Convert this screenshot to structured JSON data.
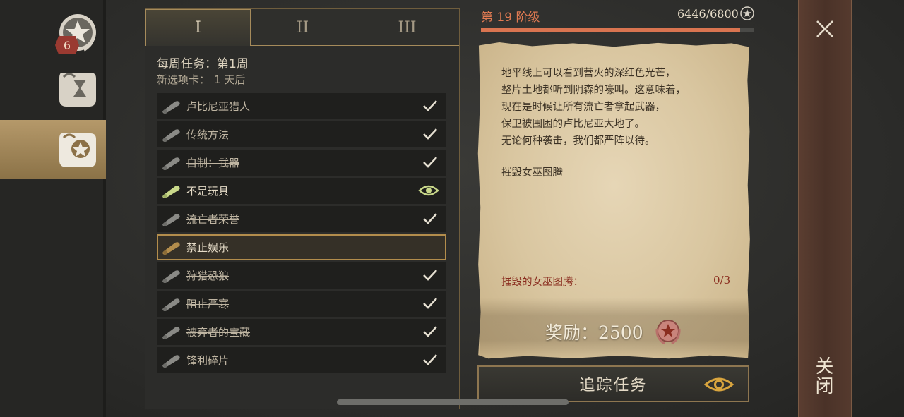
{
  "side_nav": {
    "badge_count": "6",
    "items": [
      {
        "icon": "laurel-star-icon"
      },
      {
        "icon": "scroll-hourglass-icon"
      },
      {
        "icon": "scroll-star-icon",
        "active": true
      }
    ]
  },
  "tabs": [
    "I",
    "II",
    "III"
  ],
  "active_tab": 0,
  "week": {
    "title": "每周任务：第1周",
    "next_card_label": "新选项卡：",
    "next_card_value": "1 天后"
  },
  "quests": [
    {
      "label": "卢比尼亚猎人",
      "state": "done"
    },
    {
      "label": "传统方法",
      "state": "done"
    },
    {
      "label": "自制：武器",
      "state": "done"
    },
    {
      "label": "不是玩具",
      "state": "tracked"
    },
    {
      "label": "流亡者荣誉",
      "state": "done"
    },
    {
      "label": "禁止娱乐",
      "state": "selected"
    },
    {
      "label": "狩猎恐狼",
      "state": "done"
    },
    {
      "label": "阻止严寒",
      "state": "done"
    },
    {
      "label": "被弃者的宝藏",
      "state": "done"
    },
    {
      "label": "锋利碎片",
      "state": "done"
    }
  ],
  "stage": {
    "label": "第 19 阶级",
    "xp": "6446/6800",
    "progress": 0.948
  },
  "detail": {
    "story_lines": [
      "地平线上可以看到营火的深红色光芒，",
      "整片土地都听到阴森的嚎叫。这意味着，",
      "现在是时候让所有流亡者拿起武器，",
      "保卫被围困的卢比尼亚大地了。",
      "无论何种袭击，我们都严阵以待。"
    ],
    "objective": "摧毁女巫图腾",
    "progress_name": "摧毁的女巫图腾：",
    "progress_value": "0/3",
    "reward": "奖励：2500"
  },
  "track_button": "追踪任务",
  "close_label": "关闭",
  "colors": {
    "accent": "#d97450",
    "gold_border": "#b38d4c",
    "check": "#e6e0d2",
    "tracked_eye": "#c9d88a",
    "progress_red": "#8a2d1f"
  }
}
